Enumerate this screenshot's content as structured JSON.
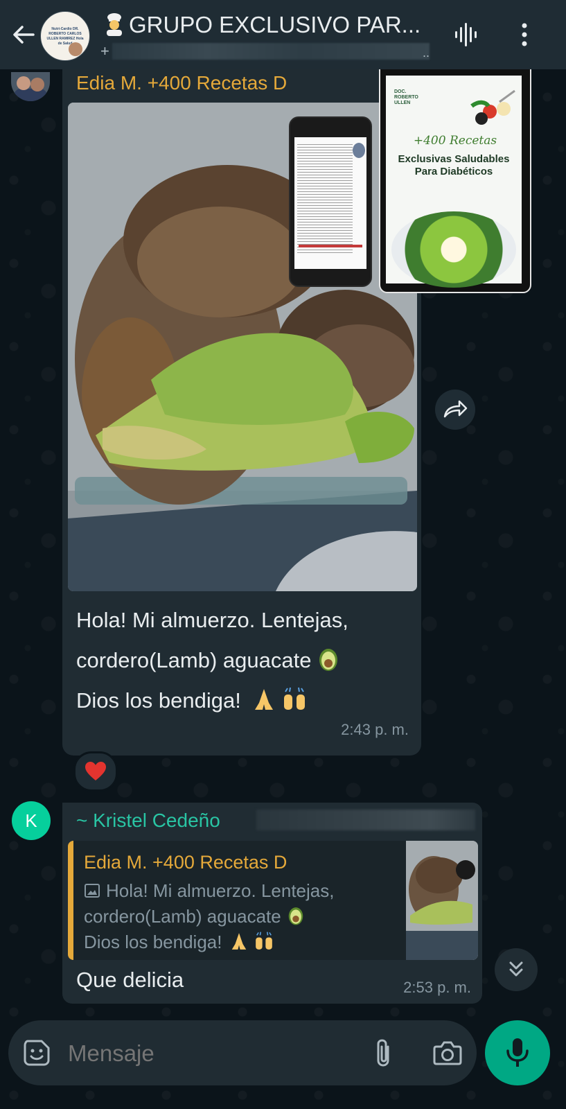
{
  "header": {
    "title": "GRUPO EXCLUSIVO PAR...",
    "subtitle_prefix": "+",
    "subtitle_suffix": ".."
  },
  "avatar_lettering": {
    "group": "Nutri-Cardio DR. ROBERTO CARLOS ULLEN RAMIREZ Hola de Salud"
  },
  "messages": [
    {
      "sender": "Edia M. +400 Recetas D",
      "sender_color": "#e5a93a",
      "text_lines": [
        "Hola! Mi almuerzo. Lentejas,",
        "cordero(Lamb) aguacate",
        "Dios los bendiga!"
      ],
      "time": "2:43 p. m.",
      "reaction": "❤️"
    },
    {
      "avatar_letter": "K",
      "sender": "~ Kristel Cedeño",
      "sender_color": "#29c5a4",
      "quote": {
        "author": "Edia M. +400 Recetas D",
        "lines": [
          "Hola! Mi almuerzo. Lentejas,",
          "cordero(Lamb) aguacate",
          "Dios los bendiga!"
        ]
      },
      "text": "Que delicia",
      "time": "2:53 p. m."
    }
  ],
  "ad": {
    "brand": "DOC. ROBERTO ULLEN",
    "script_title": "+400 Recetas",
    "title_line1": "Exclusivas Saludables",
    "title_line2": "Para Diabéticos"
  },
  "input": {
    "placeholder": "Mensaje"
  },
  "colors": {
    "header_bg": "#1f2c34",
    "bubble_bg": "#202c33",
    "accent": "#00a884",
    "chat_bg": "#0b141a"
  },
  "icons": [
    "back-arrow-icon",
    "voice-call-icon",
    "menu-icon",
    "forward-icon",
    "heart-icon",
    "image-icon",
    "chevron-down-icon",
    "sticker-icon",
    "attach-icon",
    "camera-icon",
    "mic-icon"
  ]
}
